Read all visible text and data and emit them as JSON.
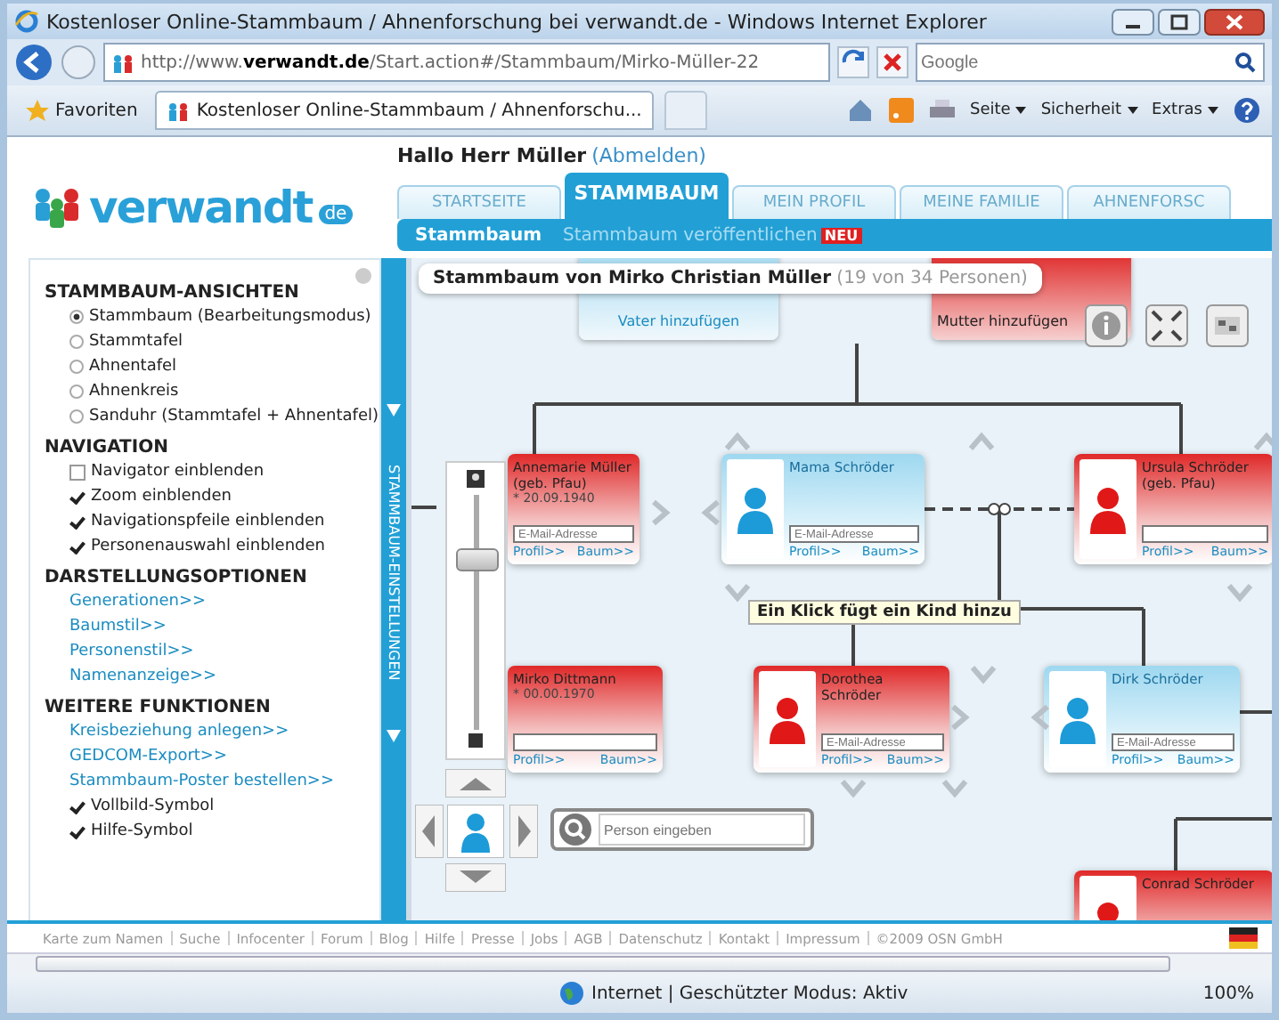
{
  "window": {
    "title": "Kostenloser Online-Stammbaum / Ahnenforschung bei verwandt.de - Windows Internet Explorer"
  },
  "address_bar": {
    "url_start": "http://www.",
    "url_domain": "verwandt.de",
    "url_rest": "/Start.action#/Stammbaum/Mirko-Müller-22",
    "search_placeholder": "Google"
  },
  "favorites_bar": {
    "favorites": "Favoriten",
    "tab": "Kostenloser Online-Stammbaum / Ahnenforschu...",
    "commands": [
      "Seite",
      "Sicherheit",
      "Extras"
    ]
  },
  "site": {
    "logo": {
      "text": "verwandt",
      "suffix": "de"
    },
    "greeting": "Hallo Herr Müller",
    "logout": "(Abmelden)",
    "tabs": [
      {
        "label": "STARTSEITE",
        "selected": false
      },
      {
        "label": "STAMMBAUM",
        "selected": true
      },
      {
        "label": "MEIN PROFIL",
        "selected": false
      },
      {
        "label": "MEINE FAMILIE",
        "selected": false
      },
      {
        "label": "AHNENFORSC",
        "selected": false
      }
    ],
    "subnav": [
      {
        "label": "Stammbaum",
        "selected": true
      },
      {
        "label": "Stammbaum veröffentlichen",
        "selected": false,
        "badge": "NEU"
      }
    ]
  },
  "settings_panel": {
    "strip_label": "STAMMBAUM-EINSTELLUNGEN",
    "sections": [
      {
        "title": "STAMMBAUM-ANSICHTEN",
        "items": [
          {
            "kind": "radio",
            "label": "Stammbaum (Bearbeitungsmodus)",
            "selected": true
          },
          {
            "kind": "radio",
            "label": "Stammtafel",
            "selected": false
          },
          {
            "kind": "radio",
            "label": "Ahnentafel",
            "selected": false
          },
          {
            "kind": "radio",
            "label": "Ahnenkreis",
            "selected": false
          },
          {
            "kind": "radio",
            "label": "Sanduhr (Stammtafel + Ahnentafel)",
            "selected": false
          }
        ]
      },
      {
        "title": "NAVIGATION",
        "items": [
          {
            "kind": "checkbox",
            "label": "Navigator einblenden",
            "checked": false
          },
          {
            "kind": "checkbox",
            "label": "Zoom einblenden",
            "checked": true
          },
          {
            "kind": "checkbox",
            "label": "Navigationspfeile einblenden",
            "checked": true
          },
          {
            "kind": "checkbox",
            "label": "Personenauswahl einblenden",
            "checked": true
          }
        ]
      },
      {
        "title": "DARSTELLUNGSOPTIONEN",
        "items": [
          {
            "kind": "link",
            "label": "Generationen>>"
          },
          {
            "kind": "link",
            "label": "Baumstil>>"
          },
          {
            "kind": "link",
            "label": "Personenstil>>"
          },
          {
            "kind": "link",
            "label": "Namenanzeige>>"
          }
        ]
      },
      {
        "title": "WEITERE FUNKTIONEN",
        "items": [
          {
            "kind": "link",
            "label": "Kreisbeziehung anlegen>>"
          },
          {
            "kind": "link",
            "label": "GEDCOM-Export>>"
          },
          {
            "kind": "link",
            "label": "Stammbaum-Poster bestellen>>"
          },
          {
            "kind": "checkbox",
            "label": "Vollbild-Symbol",
            "checked": true
          },
          {
            "kind": "checkbox",
            "label": "Hilfe-Symbol",
            "checked": true
          }
        ]
      }
    ]
  },
  "tree": {
    "title": "Stammbaum von Mirko Christian Müller",
    "count": "(19 von 34 Personen)",
    "tooltip": "Ein Klick fügt ein Kind hinzu",
    "search_placeholder": "Person eingeben",
    "zoom": {
      "level": 0.75
    },
    "add_cards": [
      {
        "label": "Vater hinzufügen",
        "kind": "male"
      },
      {
        "label": "Mutter hinzufügen",
        "kind": "female"
      }
    ],
    "persons": [
      {
        "name": "Annemarie Müller (geb. Pfau)",
        "date": "* 20.09.1940",
        "kind": "female",
        "email_placeholder": "E-Mail-Adresse",
        "profile_link": "Profil>>",
        "tree_link": "Baum>>"
      },
      {
        "name": "Mama Schröder",
        "kind": "male",
        "email_placeholder": "E-Mail-Adresse",
        "profile_link": "Profil>>",
        "tree_link": "Baum>>"
      },
      {
        "name": "Ursula Schröder (geb. Pfau)",
        "kind": "female",
        "profile_link": "Profil>>",
        "tree_link": "Baum>>"
      },
      {
        "name": "Mirko Dittmann",
        "date": "* 00.00.1970",
        "kind": "female",
        "profile_link": "Profil>>",
        "tree_link": "Baum>>"
      },
      {
        "name": "Dorothea Schröder",
        "kind": "female",
        "email_placeholder": "E-Mail-Adresse",
        "profile_link": "Profil>>",
        "tree_link": "Baum>>"
      },
      {
        "name": "Dirk Schröder",
        "kind": "male",
        "email_placeholder": "E-Mail-Adresse",
        "profile_link": "Profil>>",
        "tree_link": "Baum>>"
      },
      {
        "name": "Conrad Schröder",
        "kind": "female"
      }
    ]
  },
  "footer_links": [
    "Karte zum Namen",
    "Suche",
    "Infocenter",
    "Forum",
    "Blog",
    "Hilfe",
    "Presse",
    "Jobs",
    "AGB",
    "Datenschutz",
    "Kontakt",
    "Impressum",
    "©2009 OSN GmbH"
  ],
  "status_bar": {
    "zone": "Internet | Geschützter Modus: Aktiv",
    "zoom": "100%"
  }
}
